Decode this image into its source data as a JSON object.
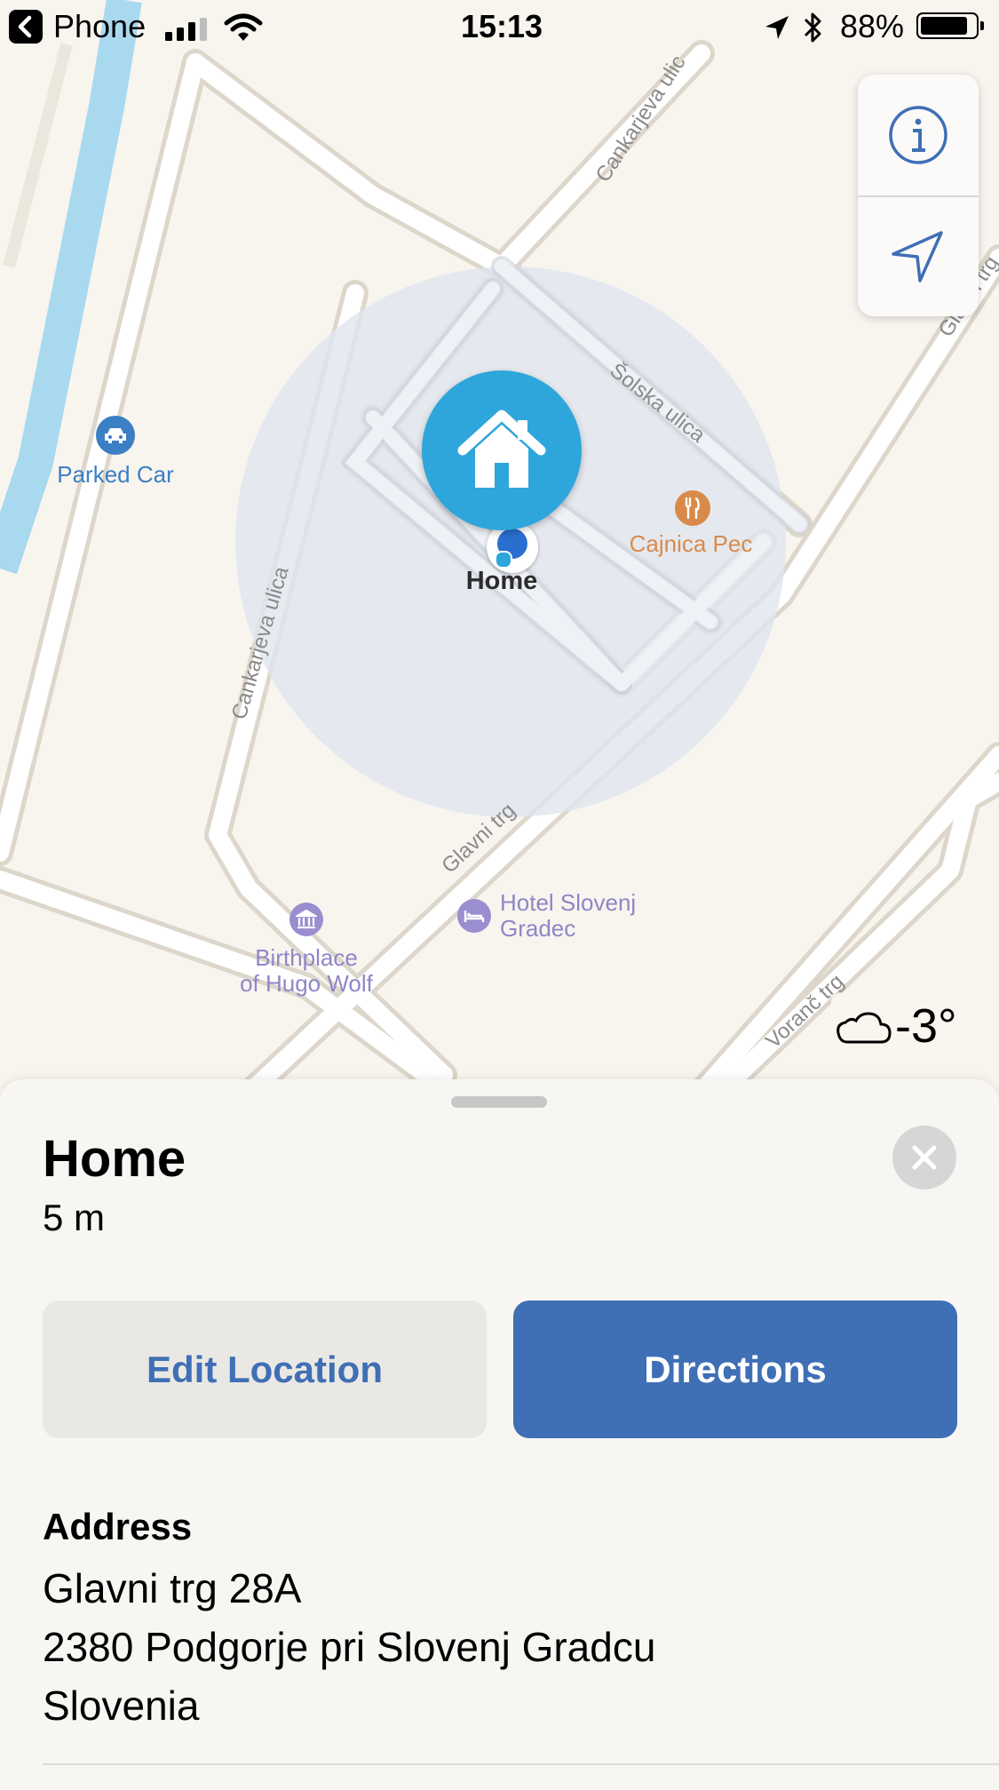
{
  "status_bar": {
    "back_app": "Phone",
    "time": "15:13",
    "battery": "88%",
    "battery_level": 0.88,
    "icons": [
      "back-chevron-icon",
      "cellular-signal-icon",
      "wifi-icon",
      "location-arrow-icon",
      "bluetooth-icon",
      "battery-icon"
    ]
  },
  "map": {
    "place_labels": {
      "parked_car": "Parked Car",
      "cajnica": "Cajnica Pec",
      "hotel": "Hotel Slovenj Gradec",
      "hotel_line1": "Hotel Slovenj",
      "hotel_line2": "Gradec",
      "birthplace_line1": "Birthplace",
      "birthplace_line2": "of Hugo Wolf",
      "home_pin": "Home"
    },
    "street_labels": {
      "cankarjeva_top": "Cankarjeva ulic",
      "cankarjeva_left": "Cankarjeva ulica",
      "solska": "Šolska ulica",
      "glavni": "Glavni trg",
      "voranc": "Voranč  trg",
      "glavni_right": "Glavni trg"
    },
    "weather": {
      "icon": "cloud-icon",
      "temperature": "-3°"
    },
    "controls": [
      "info-icon",
      "navigation-arrow-icon"
    ],
    "colors": {
      "pin": "#2ea6dc",
      "accuracy_circle": "#dfe5ee",
      "water": "#a9d9ef",
      "poi_blue": "#3b7fc4",
      "poi_orange": "#d98a4a",
      "poi_purple": "#9a8ed0"
    }
  },
  "sheet": {
    "title": "Home",
    "distance": "5 m",
    "buttons": {
      "edit": "Edit Location",
      "directions": "Directions"
    },
    "address_header": "Address",
    "address_lines": [
      "Glavni trg 28A",
      "2380 Podgorje pri Slovenj Gradcu",
      "Slovenia"
    ],
    "colors": {
      "primary": "#3f6fb5",
      "secondary_bg": "#eae8e4",
      "secondary_text": "#3f6fb5"
    }
  }
}
